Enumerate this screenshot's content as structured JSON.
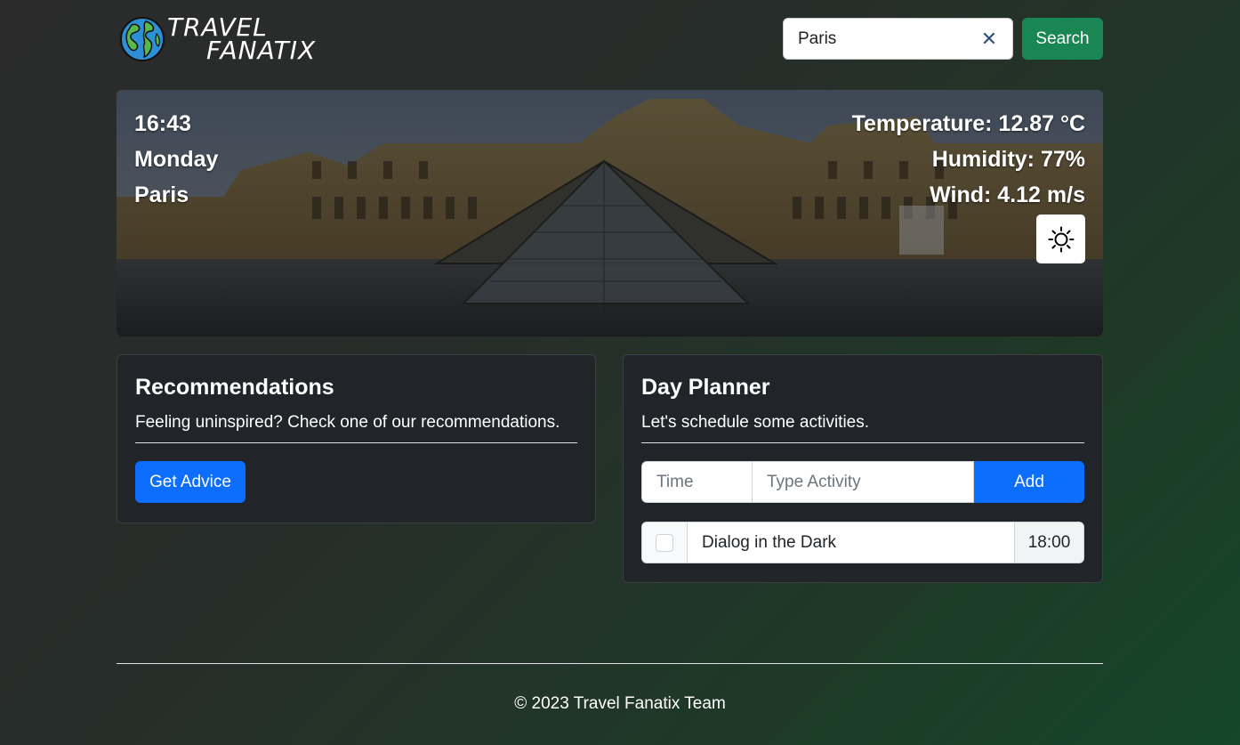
{
  "brand": {
    "line1": "TRAVEL",
    "line2": "FANATIX",
    "icon": "globe-icon"
  },
  "search": {
    "value": "Paris",
    "clear_icon": "close-icon",
    "button_label": "Search"
  },
  "hero": {
    "time": "16:43",
    "day": "Monday",
    "city": "Paris",
    "temperature": "Temperature: 12.87 °C",
    "humidity": "Humidity: 77%",
    "wind": "Wind: 4.12 m/s",
    "theme_icon": "sun-icon"
  },
  "recommendations": {
    "title": "Recommendations",
    "text": "Feeling uninspired? Check one of our recommendations.",
    "button_label": "Get Advice"
  },
  "planner": {
    "title": "Day Planner",
    "text": "Let's schedule some activities.",
    "time_placeholder": "Time",
    "activity_placeholder": "Type Activity",
    "add_label": "Add",
    "tasks": [
      {
        "checked": false,
        "name": "Dialog in the Dark",
        "time": "18:00"
      }
    ]
  },
  "footer": {
    "text": "© 2023 Travel Fanatix Team"
  },
  "colors": {
    "search_button": "#198754",
    "primary": "#0d6efd",
    "card_bg": "#212529"
  }
}
